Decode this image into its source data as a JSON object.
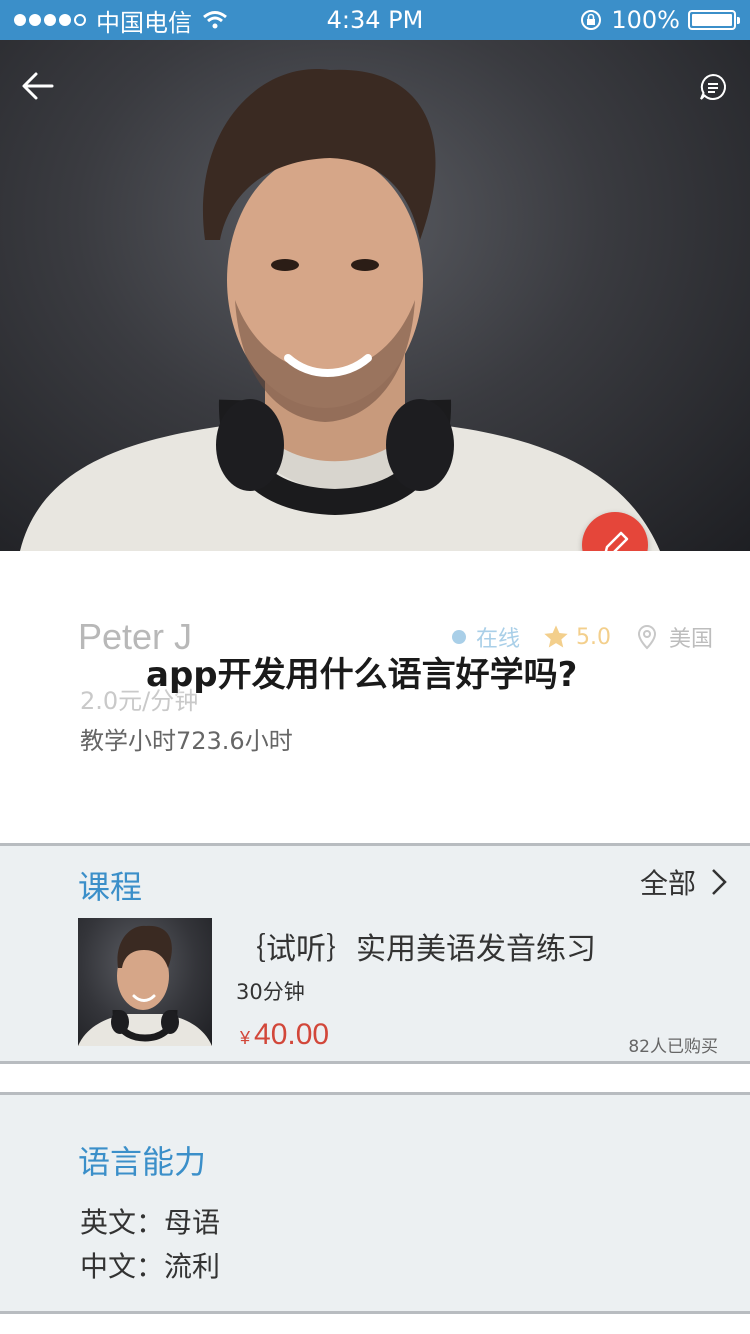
{
  "status_bar": {
    "carrier": "中国电信",
    "time": "4:34 PM",
    "battery": "100%",
    "battery_level": 1.0,
    "signal_bars_filled": 4,
    "signal_bars_total": 5
  },
  "hero": {
    "back_icon": "back-arrow-icon",
    "message_icon": "message-icon",
    "photo": "teacher-portrait-photo"
  },
  "edit_button": {
    "icon": "pencil-icon",
    "color": "#e5463a"
  },
  "profile": {
    "name": "Peter J",
    "online": "在线",
    "rating": "5.0",
    "country": "美国",
    "price": "2.0元/分钟",
    "teaching_hours": "教学小时723.6小时"
  },
  "overlay_title": "app开发用什么语言好学吗?",
  "course_section": {
    "title": "课程",
    "all_label": "全部",
    "course": {
      "name": "｛试听｝实用美语发音练习",
      "duration": "30分钟",
      "currency": "¥",
      "price": "40.00",
      "sold": "82人已购买"
    }
  },
  "language_section": {
    "title": "语言能力",
    "english": "英文：母语",
    "chinese": "中文：流利"
  },
  "colors": {
    "status_bar": "#3b8fc9",
    "accent_blue": "#3b8fc9",
    "price_red": "#d2473a",
    "section_bg": "#ecf0f2"
  }
}
